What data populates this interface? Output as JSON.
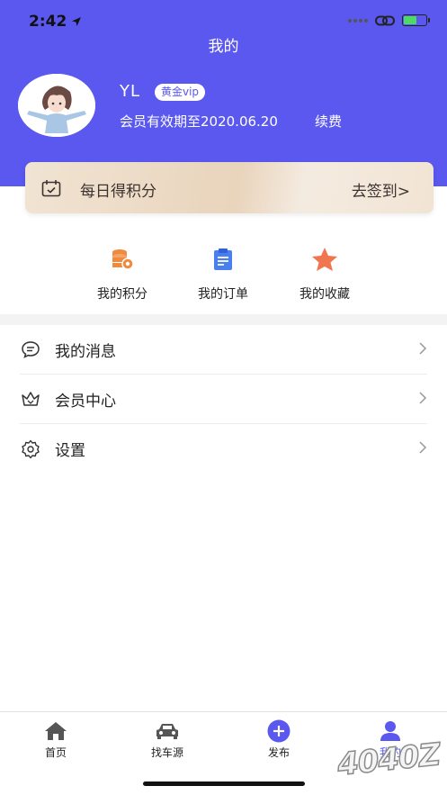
{
  "status_bar": {
    "time": "2:42"
  },
  "header": {
    "title": "我的"
  },
  "profile": {
    "username": "YL",
    "vip_badge": "黄金vip",
    "expiry": "会员有效期至2020.06.20",
    "renew": "续费"
  },
  "checkin": {
    "label": "每日得积分",
    "action": "去签到>"
  },
  "quick_actions": [
    {
      "label": "我的积分",
      "icon": "coins-icon"
    },
    {
      "label": "我的订单",
      "icon": "clipboard-icon"
    },
    {
      "label": "我的收藏",
      "icon": "star-icon"
    }
  ],
  "menu": [
    {
      "label": "我的消息",
      "icon": "message-icon"
    },
    {
      "label": "会员中心",
      "icon": "crown-icon"
    },
    {
      "label": "设置",
      "icon": "gear-icon"
    }
  ],
  "tabbar": [
    {
      "label": "首页",
      "icon": "home-icon",
      "active": false
    },
    {
      "label": "找车源",
      "icon": "car-icon",
      "active": false
    },
    {
      "label": "发布",
      "icon": "plus-icon",
      "active": false
    },
    {
      "label": "我的",
      "icon": "user-icon",
      "active": true
    }
  ],
  "colors": {
    "primary": "#5a58ee",
    "coins": "#f08a3c",
    "order": "#4a7ff0",
    "star": "#f07650"
  },
  "watermark": "4040Z"
}
